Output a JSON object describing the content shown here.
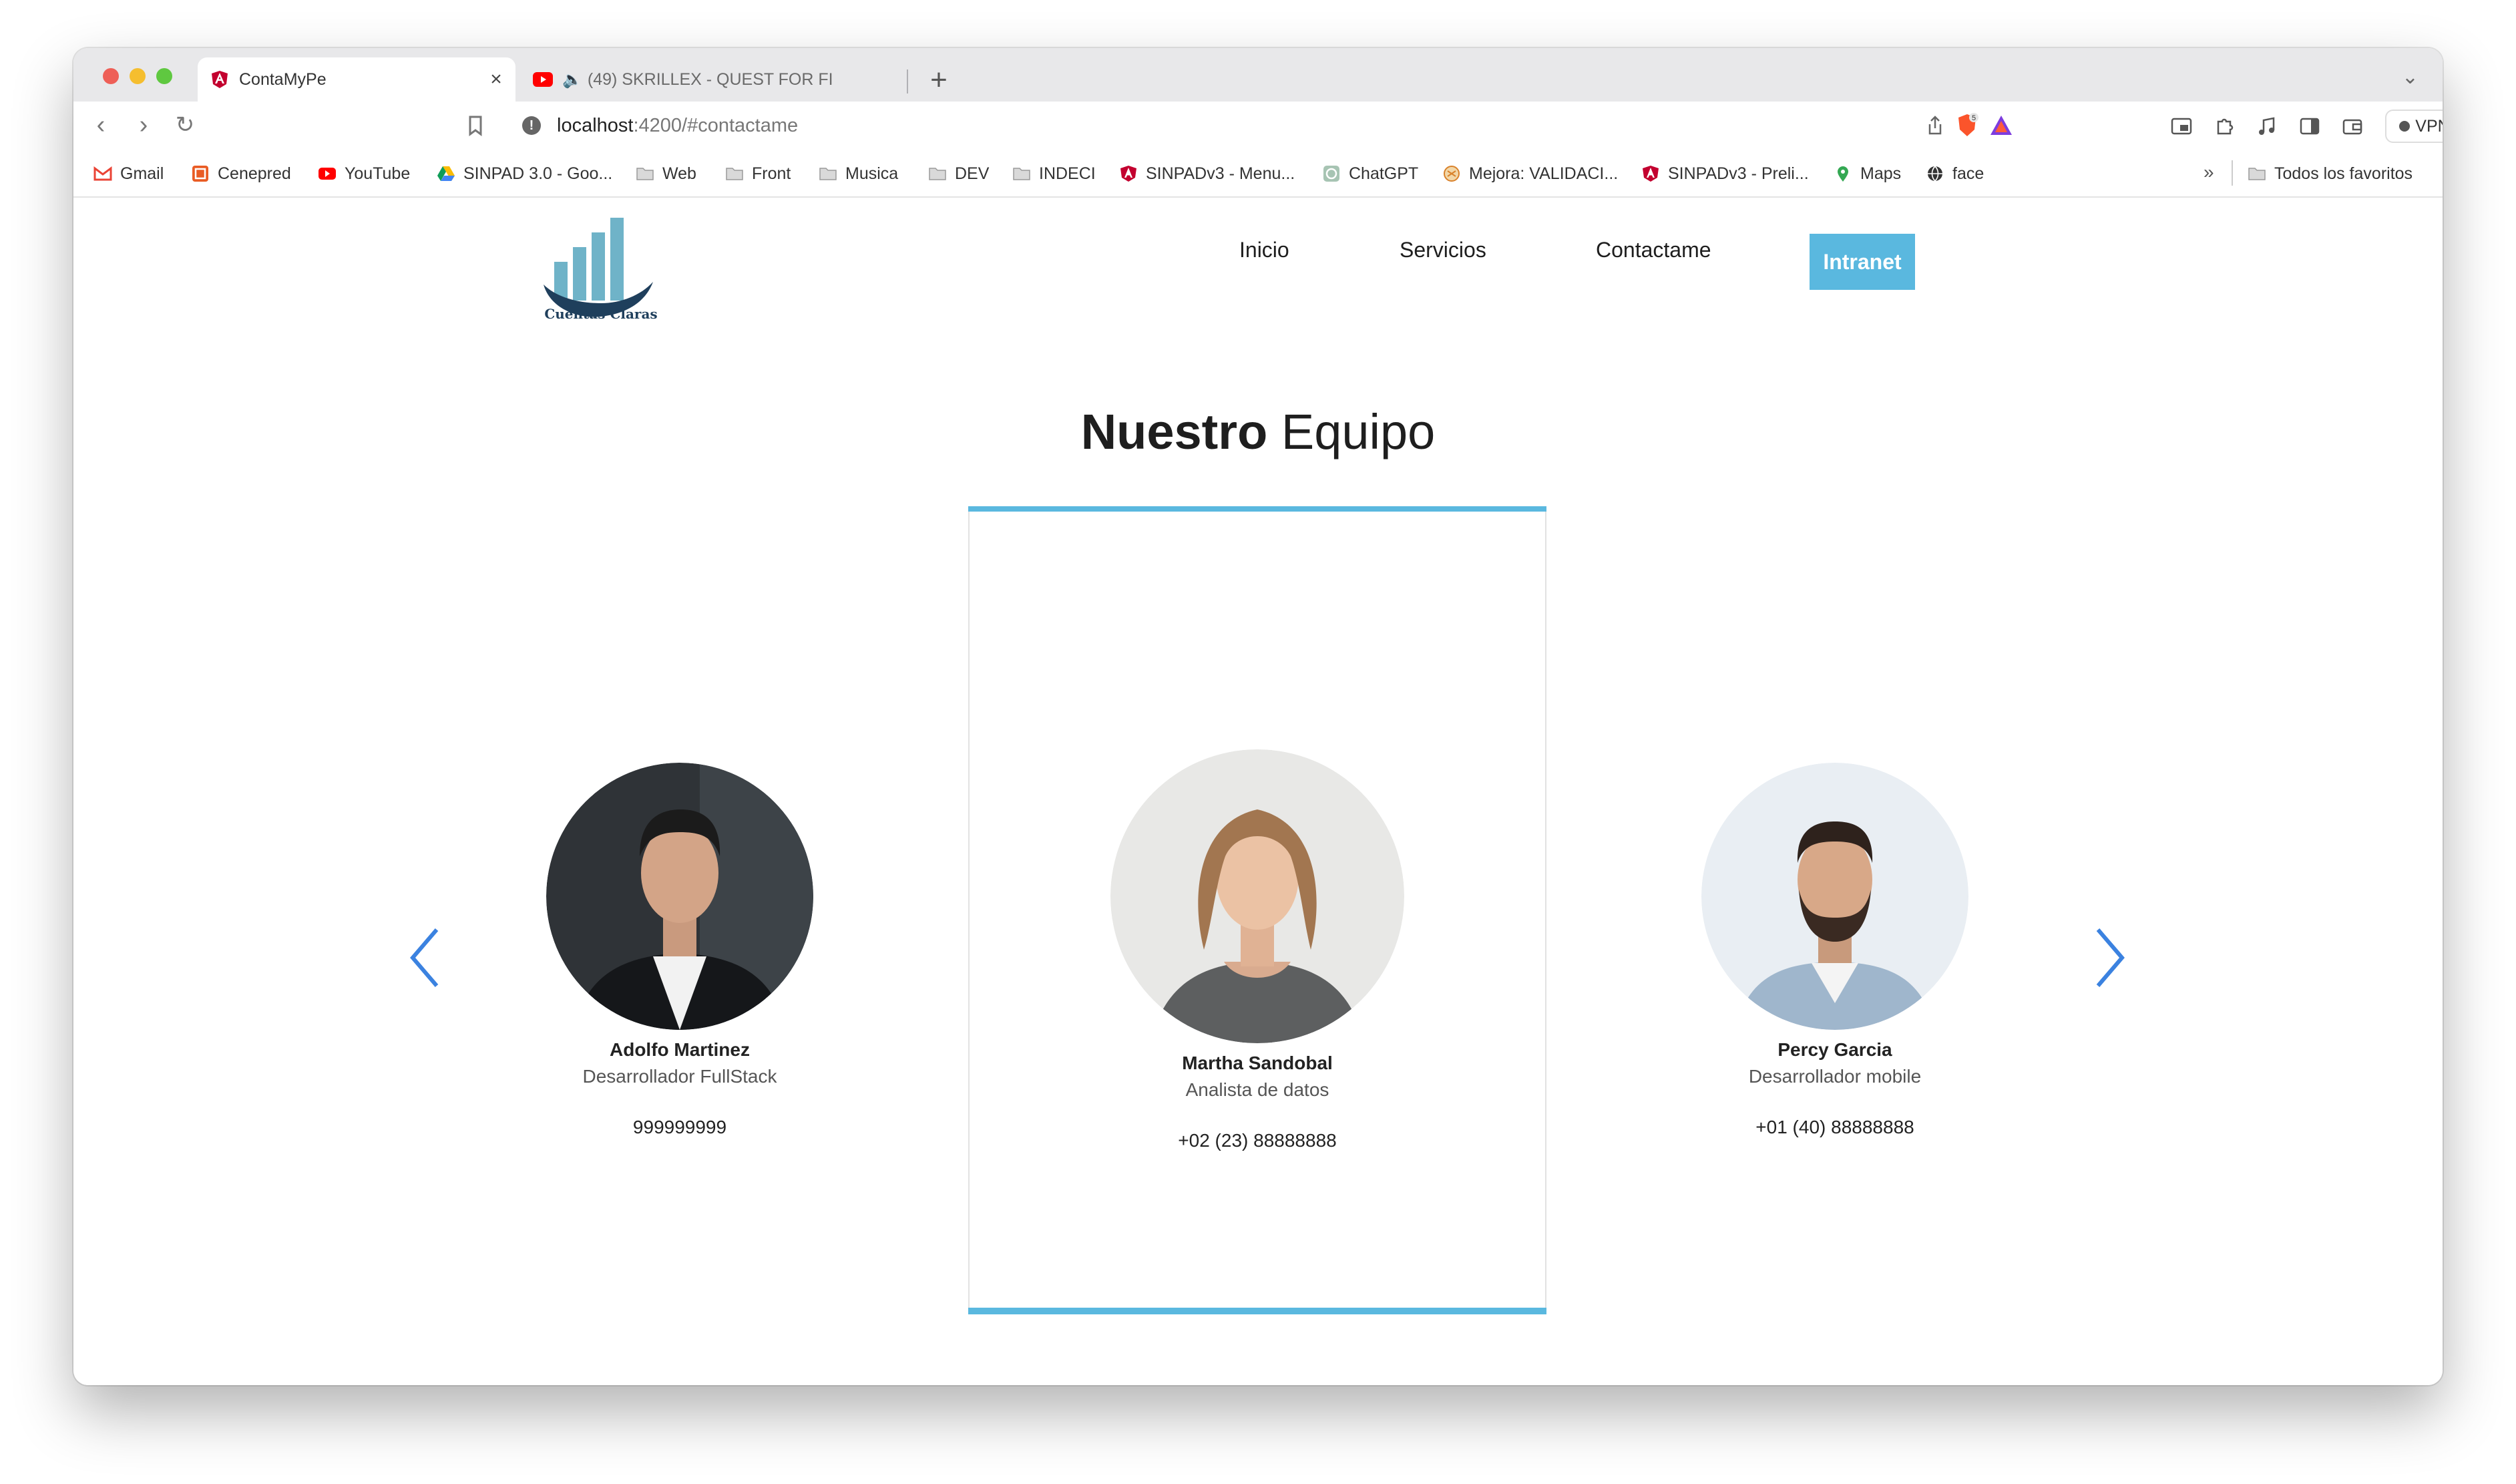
{
  "browser": {
    "tabs": [
      {
        "title": "ContaMyPe",
        "active": true
      },
      {
        "title": "(49) SKRILLEX - QUEST FOR FI",
        "active": false,
        "audio": true
      }
    ],
    "new_tab_label": "+",
    "url": {
      "host": "localhost",
      "path": ":4200/#contactame"
    },
    "vpn_label": "VPN",
    "shield_badge": "5",
    "bookmarks": [
      {
        "label": "Gmail",
        "icon": "gmail-icon"
      },
      {
        "label": "Cenepred",
        "icon": "cenepred-icon"
      },
      {
        "label": "YouTube",
        "icon": "youtube-icon"
      },
      {
        "label": "SINPAD 3.0 - Goo...",
        "icon": "drive-icon"
      },
      {
        "label": "Web",
        "icon": "folder-icon"
      },
      {
        "label": "Front",
        "icon": "folder-icon"
      },
      {
        "label": "Musica",
        "icon": "folder-icon"
      },
      {
        "label": "DEV",
        "icon": "folder-icon"
      },
      {
        "label": "INDECI",
        "icon": "folder-icon"
      },
      {
        "label": "SINPADv3 - Menu...",
        "icon": "angular-icon"
      },
      {
        "label": "ChatGPT",
        "icon": "chatgpt-icon"
      },
      {
        "label": "Mejora: VALIDACI...",
        "icon": "mejora-icon"
      },
      {
        "label": "SINPADv3 - Preli...",
        "icon": "angular-icon"
      },
      {
        "label": "Maps",
        "icon": "maps-icon"
      },
      {
        "label": "face",
        "icon": "globe-icon"
      }
    ],
    "bookmarks_more": "»",
    "all_bookmarks_label": "Todos los favoritos"
  },
  "site": {
    "logo_text": "Cuentas Claras",
    "nav": {
      "inicio": "Inicio",
      "servicios": "Servicios",
      "contactame": "Contactame",
      "intranet": "Intranet"
    },
    "section_title_bold": "Nuestro",
    "section_title_rest": "Equipo",
    "team": [
      {
        "name": "Adolfo Martinez",
        "role": "Desarrollador FullStack",
        "phone": "999999999"
      },
      {
        "name": "Martha Sandobal",
        "role": "Analista de datos",
        "phone": "+02 (23) 88888888"
      },
      {
        "name": "Percy Garcia",
        "role": "Desarrollador mobile",
        "phone": "+01 (40) 88888888"
      }
    ]
  },
  "colors": {
    "accent": "#5ab8df",
    "arrow": "#3b82e0",
    "logo_dark": "#1f3f5c"
  }
}
